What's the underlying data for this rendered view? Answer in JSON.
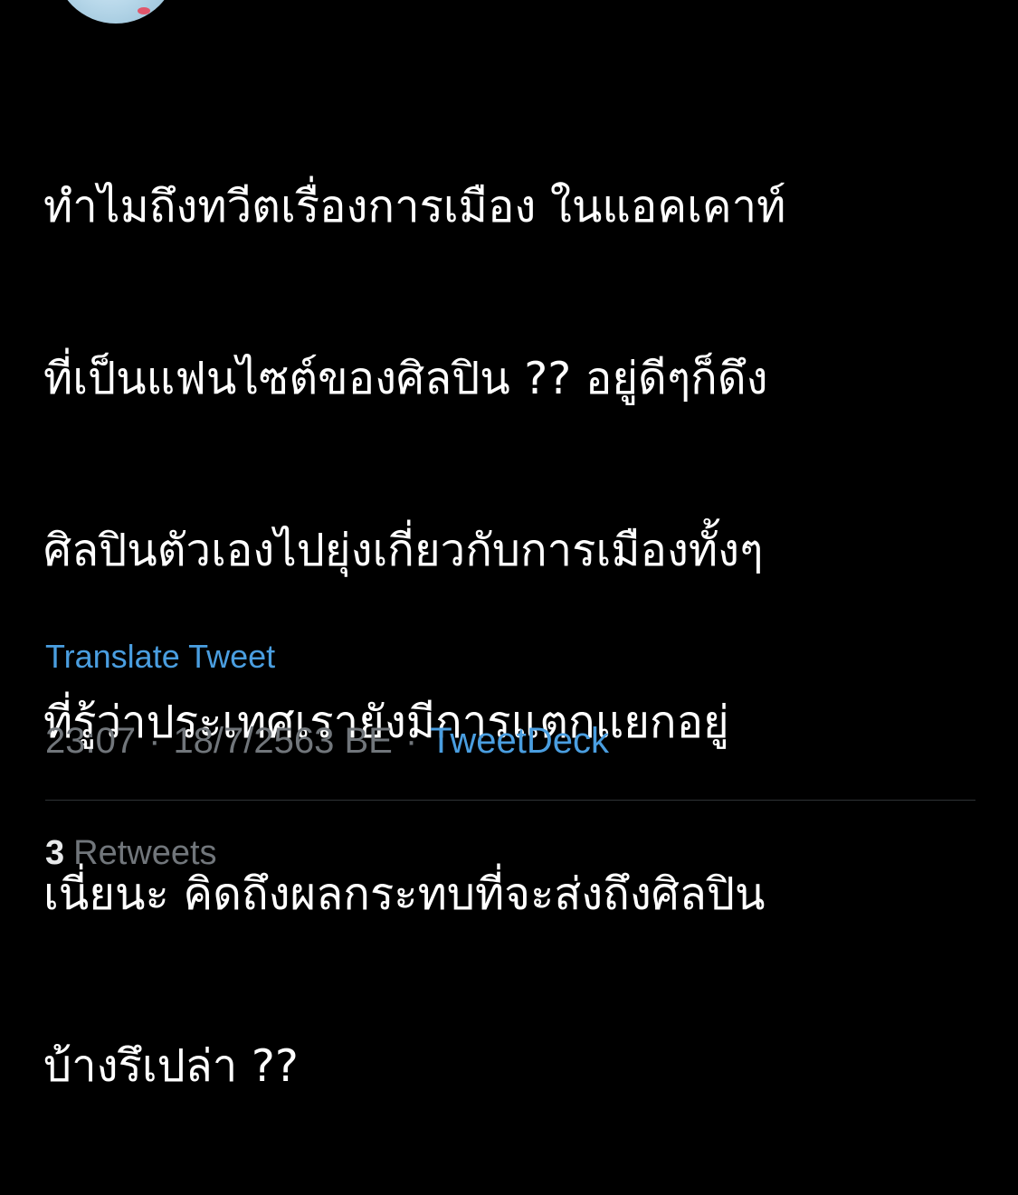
{
  "tweet": {
    "text_lines": [
      "ทำไมถึงทวีตเรื่องการเมือง ในแอคเคาท์",
      "ที่เป็นแฟนไซต์ของศิลปิน ?? อยู่ดีๆก็ดึง",
      "ศิลปินตัวเองไปยุ่งเกี่ยวกับการเมืองทั้งๆ",
      "ที่รู้ว่าประเทศเรายังมีการแตกแยกอยู่",
      "เนี่ยนะ คิดถึงผลกระทบที่จะส่งถึงศิลปิน",
      "บ้างรึเปล่า ??"
    ],
    "translate_label": "Translate Tweet",
    "time": "23:07",
    "date": "18/7/2563 BE",
    "separator": "·",
    "source": "TweetDeck",
    "retweet_count": "3",
    "retweet_label": "Retweets"
  },
  "colors": {
    "background": "#000000",
    "text": "#ffffff",
    "link": "#4a9ee0",
    "muted": "#71767b",
    "divider": "#2f3336"
  },
  "icons": {
    "avatar": "user-avatar"
  }
}
